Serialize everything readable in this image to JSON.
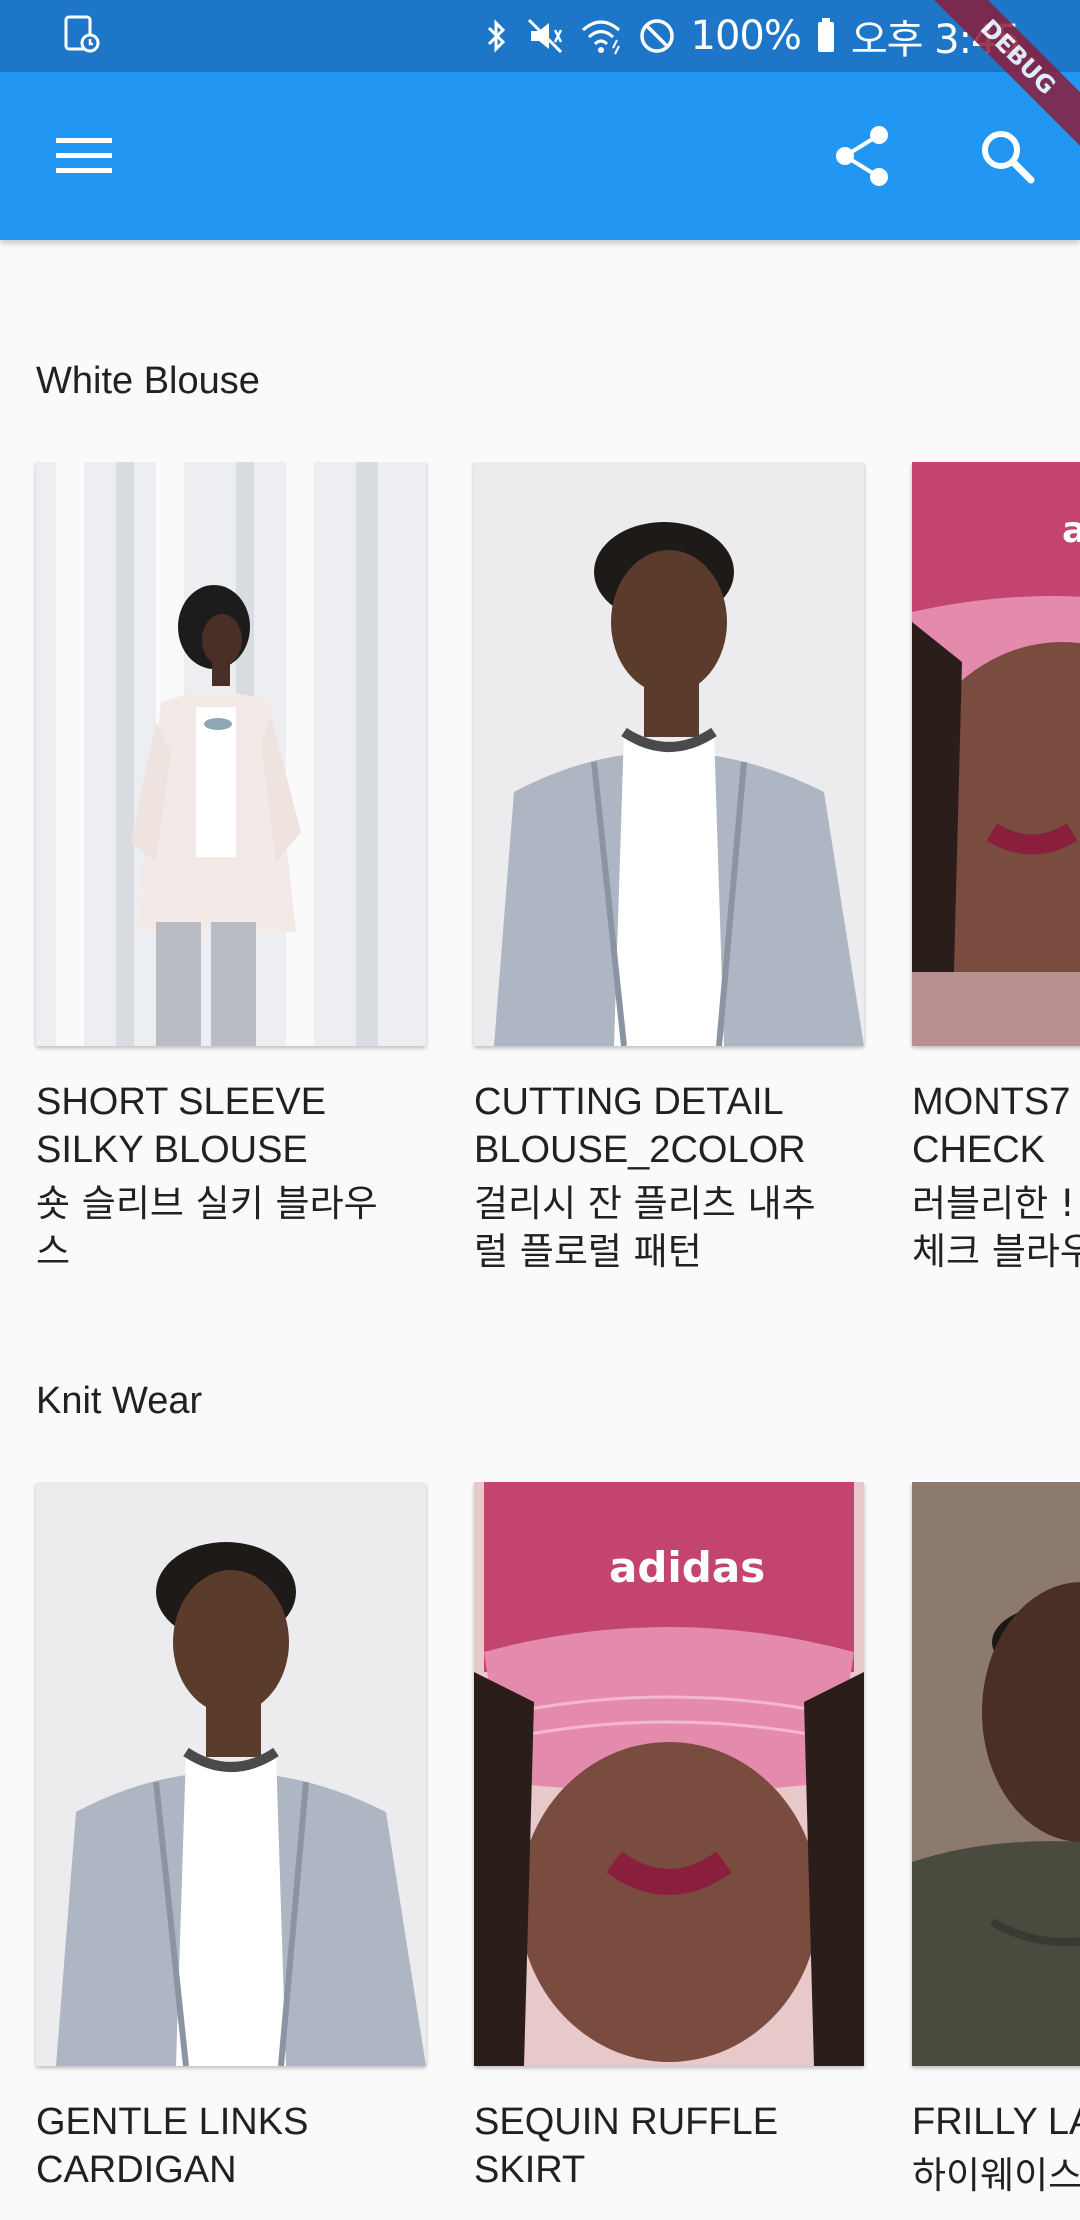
{
  "status_bar": {
    "battery": "100%",
    "time": "오후 3:45",
    "icons": [
      "screenshot-icon",
      "bluetooth-icon",
      "mute-icon",
      "wifi-icon",
      "do-not-disturb-icon",
      "battery-icon"
    ]
  },
  "debug_banner": "DEBUG",
  "app_bar": {
    "background": "#2196f3",
    "icons": [
      "menu-icon",
      "share-icon",
      "search-icon"
    ]
  },
  "sections": [
    {
      "title": "White Blouse",
      "items": [
        {
          "title": "SHORT SLEEVE\nSILKY BLOUSE",
          "subtitle": "숏 슬리브 실키 블라우\n스",
          "image": "woman-white-blazer-photo"
        },
        {
          "title": "CUTTING DETAIL\nBLOUSE_2COLOR",
          "subtitle": "걸리시 잔 플리츠 내추\n럴 플로럴 패턴",
          "image": "man-grey-blazer-photo"
        },
        {
          "title": "MONTS7\nCHECK",
          "subtitle": "러블리한 !\n체크 블라우",
          "image": "pink-adidas-cap-photo"
        }
      ]
    },
    {
      "title": "Knit Wear",
      "items": [
        {
          "title": "GENTLE LINKS\nCARDIGAN",
          "subtitle": "",
          "image": "man-grey-blazer-photo"
        },
        {
          "title": "SEQUIN RUFFLE\nSKIRT",
          "subtitle": "",
          "image": "pink-adidas-cap-photo"
        },
        {
          "title": "FRILLY LA",
          "subtitle": "하이웨이스",
          "image": "man-bomber-jacket-photo"
        }
      ]
    }
  ]
}
